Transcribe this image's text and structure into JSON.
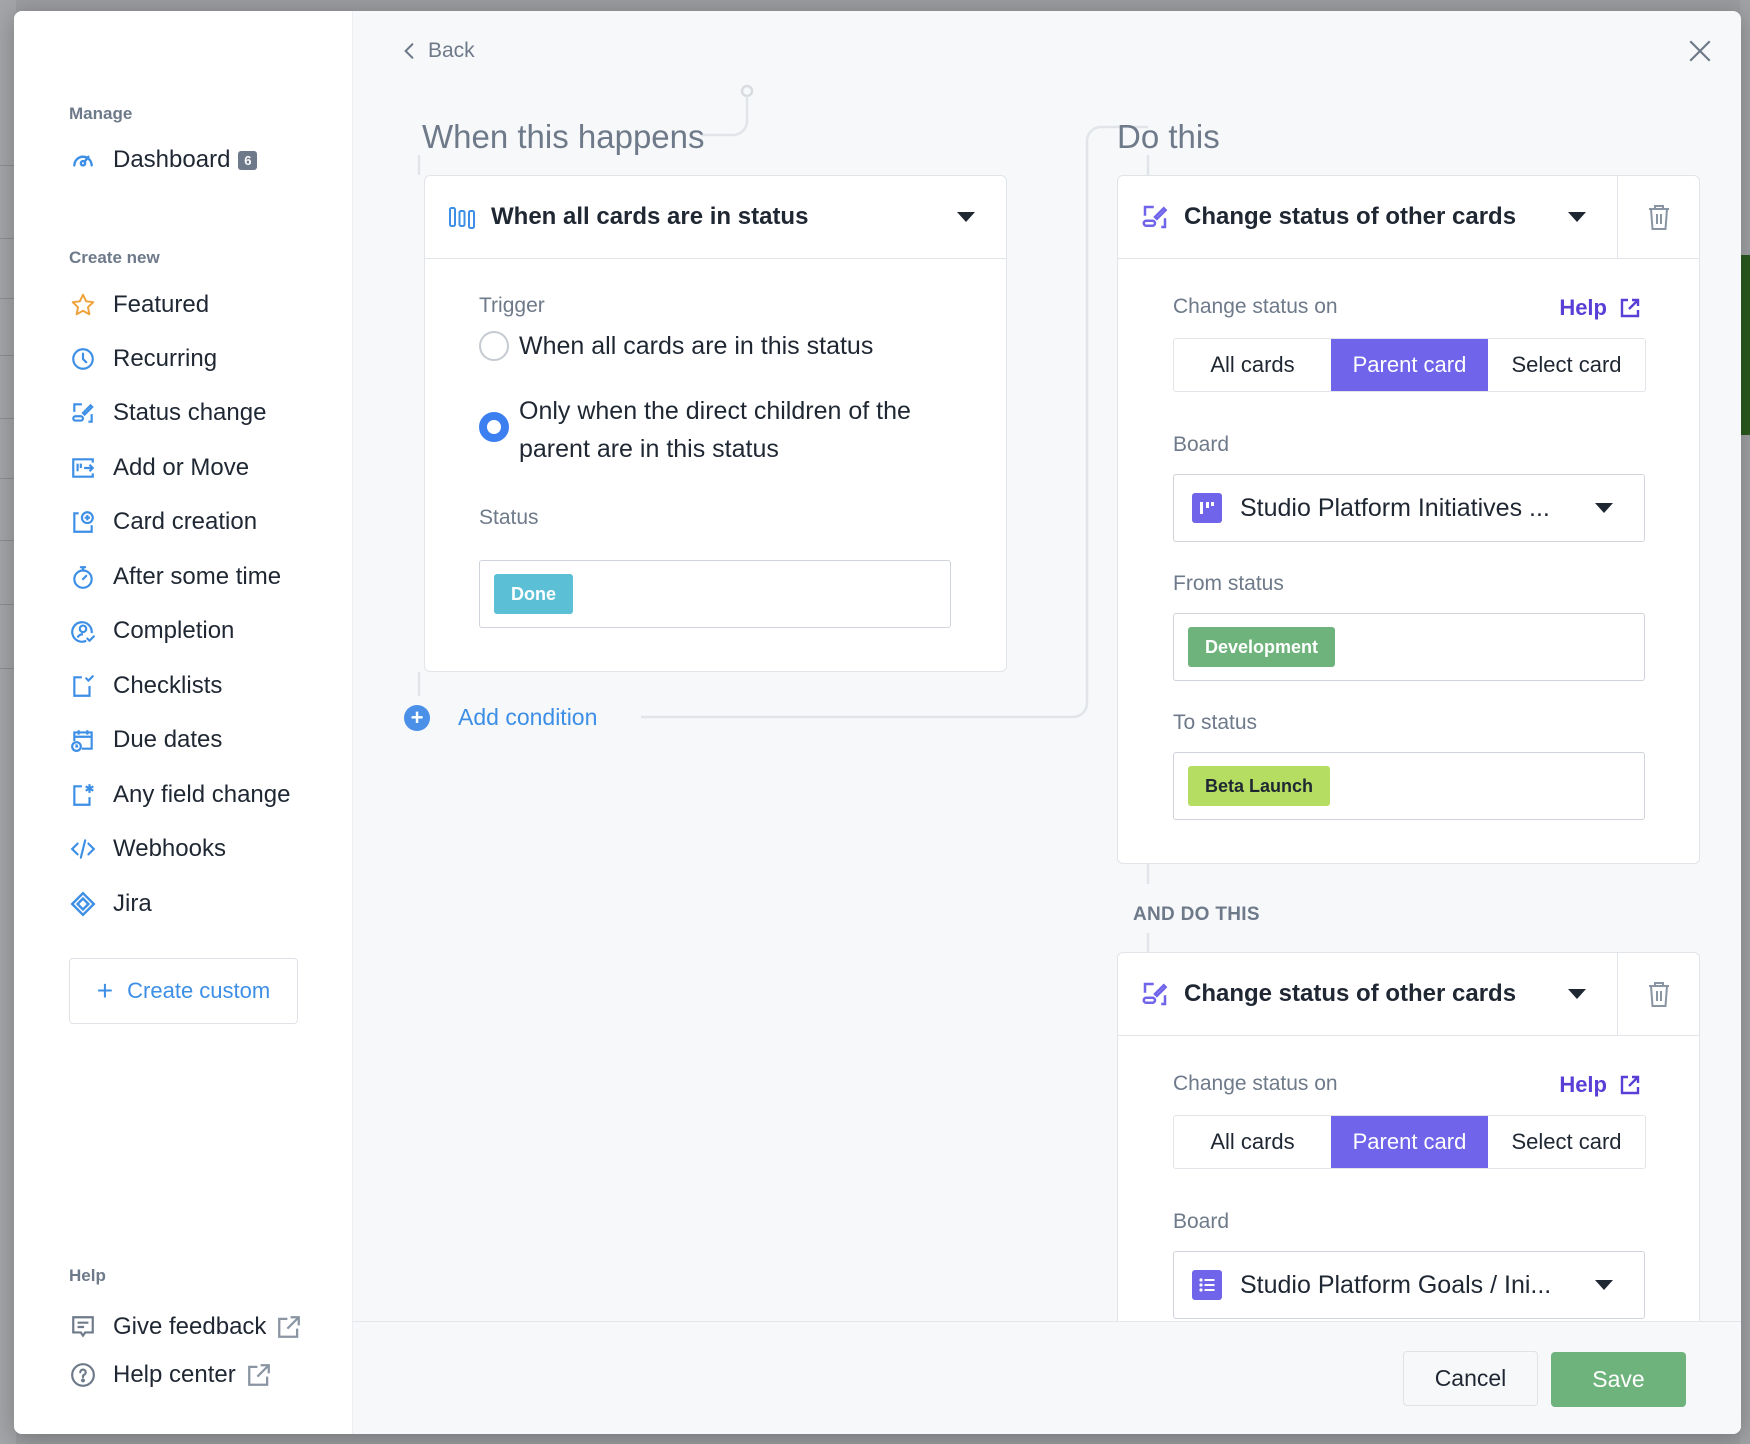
{
  "sidebar": {
    "manage_label": "Manage",
    "dashboard": {
      "label": "Dashboard",
      "badge": "6"
    },
    "create_new_label": "Create new",
    "items": [
      {
        "label": "Featured",
        "icon": "star-icon"
      },
      {
        "label": "Recurring",
        "icon": "clock-icon"
      },
      {
        "label": "Status change",
        "icon": "status-change-icon"
      },
      {
        "label": "Add or Move",
        "icon": "add-move-icon"
      },
      {
        "label": "Card creation",
        "icon": "card-creation-icon"
      },
      {
        "label": "After some time",
        "icon": "stopwatch-icon"
      },
      {
        "label": "Completion",
        "icon": "user-check-icon"
      },
      {
        "label": "Checklists",
        "icon": "checklist-icon"
      },
      {
        "label": "Due dates",
        "icon": "calendar-clock-icon"
      },
      {
        "label": "Any field change",
        "icon": "field-asterisk-icon"
      },
      {
        "label": "Webhooks",
        "icon": "code-icon"
      },
      {
        "label": "Jira",
        "icon": "jira-icon"
      }
    ],
    "create_custom": "Create custom",
    "help_label": "Help",
    "help_items": [
      {
        "label": "Give feedback",
        "icon": "feedback-icon"
      },
      {
        "label": "Help center",
        "icon": "question-circle-icon"
      }
    ]
  },
  "header": {
    "back_label": "Back"
  },
  "trigger": {
    "heading": "When this happens",
    "type_title": "When all cards are in status",
    "trigger_label": "Trigger",
    "options": [
      {
        "label": "When all cards are in this status",
        "checked": false
      },
      {
        "label": "Only when the direct children of the parent are in this status",
        "checked": true
      }
    ],
    "status_label": "Status",
    "status_value": "Done",
    "add_condition": "Add condition"
  },
  "actions": {
    "heading": "Do this",
    "and_do_this": "AND DO THIS",
    "items": [
      {
        "title": "Change status of other cards",
        "change_status_on_label": "Change status on",
        "help": "Help",
        "segments": [
          "All cards",
          "Parent card",
          "Select card"
        ],
        "selected_segment": "Parent card",
        "board_label": "Board",
        "board_value": "Studio Platform Initiatives ...",
        "board_icon": "board-columns-icon",
        "from_status_label": "From status",
        "from_status": "Development",
        "to_status_label": "To status",
        "to_status": "Beta Launch"
      },
      {
        "title": "Change status of other cards",
        "change_status_on_label": "Change status on",
        "help": "Help",
        "segments": [
          "All cards",
          "Parent card",
          "Select card"
        ],
        "selected_segment": "Parent card",
        "board_label": "Board",
        "board_value": "Studio Platform Goals / Ini...",
        "board_icon": "board-list-icon"
      }
    ]
  },
  "footer": {
    "cancel": "Cancel",
    "save": "Save"
  },
  "colors": {
    "accent_purple": "#6f64ea",
    "link_blue": "#3d8fe6",
    "radio_blue": "#3b7ff0",
    "save_green": "#6fb37c",
    "status_done": "#5bc0d6",
    "status_development": "#6fb37c",
    "status_beta_launch": "#b5dd62",
    "help_purple": "#5a3fd6"
  }
}
